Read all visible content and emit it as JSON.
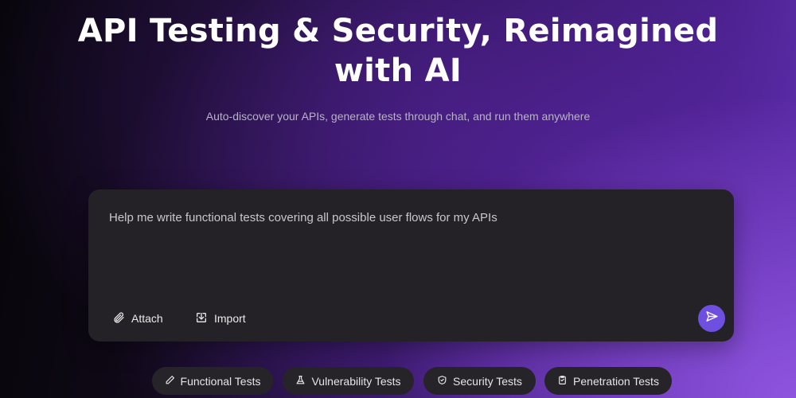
{
  "hero": {
    "title_line1": "API Testing & Security, Reimagined",
    "title_line2": "with AI",
    "subtitle": "Auto-discover your APIs, generate tests through chat, and run them anywhere"
  },
  "chat": {
    "input_value": "Help me write functional tests covering all possible user flows for my APIs",
    "attach_label": "Attach",
    "import_label": "Import",
    "send_icon": "send-icon",
    "send_color": "#6f4fe0"
  },
  "chips": [
    {
      "label": "Functional Tests",
      "icon": "pencil-icon"
    },
    {
      "label": "Vulnerability Tests",
      "icon": "flask-icon"
    },
    {
      "label": "Security Tests",
      "icon": "shield-icon"
    },
    {
      "label": "Penetration Tests",
      "icon": "clipboard-icon"
    }
  ],
  "colors": {
    "accent": "#6f4fe0",
    "panel": "#242226",
    "chip": "#262428"
  }
}
